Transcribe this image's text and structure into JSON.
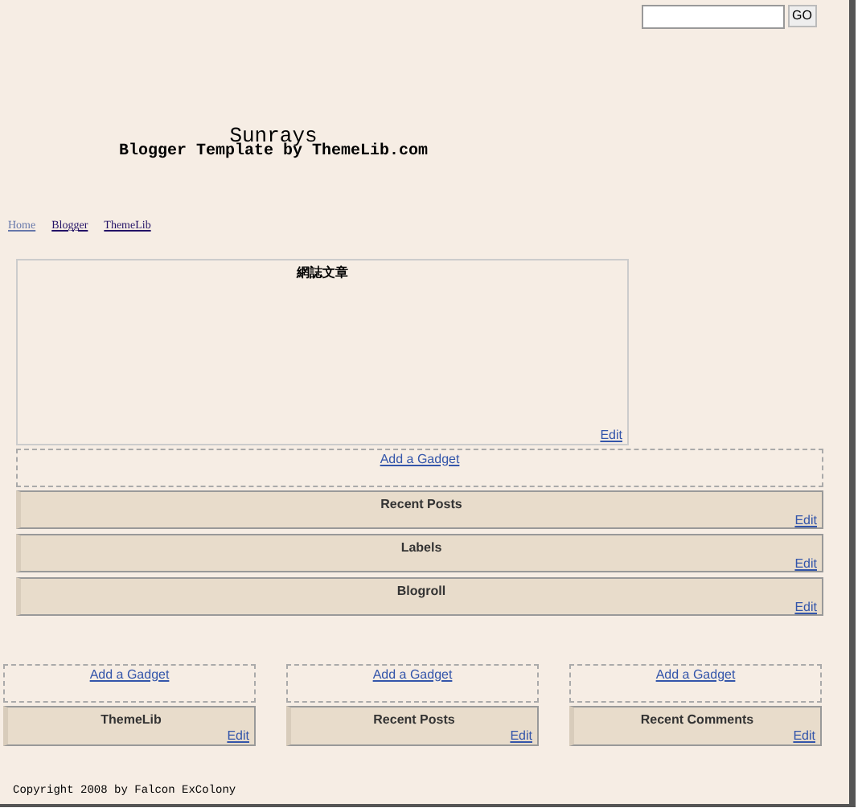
{
  "search": {
    "button": "GO"
  },
  "header": {
    "title": "Sunrays",
    "subtitle": "Blogger Template by ThemeLib.com"
  },
  "nav": [
    {
      "label": "Home",
      "visited": true
    },
    {
      "label": "Blogger",
      "visited": false
    },
    {
      "label": "ThemeLib",
      "visited": false
    }
  ],
  "main": {
    "post_box": {
      "title": "網誌文章",
      "edit": "Edit"
    },
    "add_gadget": "Add a Gadget",
    "widgets": [
      {
        "title": "Recent Posts",
        "edit": "Edit"
      },
      {
        "title": "Labels",
        "edit": "Edit"
      },
      {
        "title": "Blogroll",
        "edit": "Edit"
      }
    ]
  },
  "footer_columns": [
    {
      "add_gadget": "Add a Gadget",
      "widgets": [
        {
          "title": "ThemeLib",
          "edit": "Edit"
        }
      ]
    },
    {
      "add_gadget": "Add a Gadget",
      "widgets": [
        {
          "title": "Recent Posts",
          "edit": "Edit"
        }
      ]
    },
    {
      "add_gadget": "Add a Gadget",
      "widgets": [
        {
          "title": "Recent Comments",
          "edit": "Edit"
        }
      ]
    }
  ],
  "copyright": "Copyright 2008 by Falcon ExColony"
}
